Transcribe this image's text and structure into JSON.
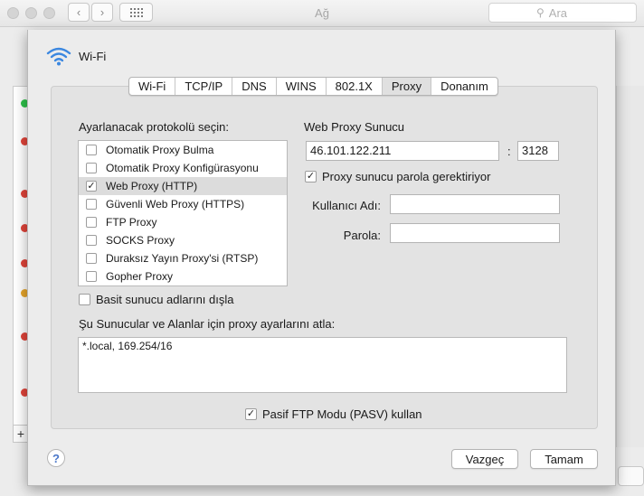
{
  "window": {
    "title": "Ağ",
    "search_placeholder": "Ara"
  },
  "sheet": {
    "interface_name": "Wi-Fi",
    "tabs": [
      "Wi-Fi",
      "TCP/IP",
      "DNS",
      "WINS",
      "802.1X",
      "Proxy",
      "Donanım"
    ],
    "active_tab": "Proxy",
    "protocol_title": "Ayarlanacak protokolü seçin:",
    "protocols": [
      {
        "label": "Otomatik Proxy Bulma",
        "checked": false
      },
      {
        "label": "Otomatik Proxy Konfigürasyonu",
        "checked": false
      },
      {
        "label": "Web Proxy (HTTP)",
        "checked": true
      },
      {
        "label": "Güvenli Web Proxy (HTTPS)",
        "checked": false
      },
      {
        "label": "FTP Proxy",
        "checked": false
      },
      {
        "label": "SOCKS Proxy",
        "checked": false
      },
      {
        "label": "Duraksız Yayın Proxy'si (RTSP)",
        "checked": false
      },
      {
        "label": "Gopher Proxy",
        "checked": false
      }
    ],
    "exclude_simple": "Basit sunucu adlarını dışla",
    "bypass_label": "Şu Sunucular ve Alanlar için proxy ayarlarını atla:",
    "bypass_value": "*.local, 169.254/16",
    "server": {
      "title": "Web Proxy Sunucu",
      "address": "46.101.122.211",
      "colon": ":",
      "port": "3128",
      "password_required": "Proxy sunucu parola gerektiriyor",
      "username_label": "Kullanıcı Adı:",
      "username_value": "",
      "password_label": "Parola:",
      "password_value": ""
    },
    "pasv_label": "Pasif FTP Modu (PASV) kullan",
    "help": "?",
    "cancel": "Vazgeç",
    "ok": "Tamam"
  },
  "colors": {
    "wifi_icon": "#3b87e0",
    "help_icon": "#4a77c9"
  },
  "sidebar_status_colors": [
    "#2ec24a",
    "#e0443a",
    "#e0443a",
    "#e0443a",
    "#e0443a",
    "#e0443a",
    "#e0443a",
    "#e6a52b"
  ]
}
